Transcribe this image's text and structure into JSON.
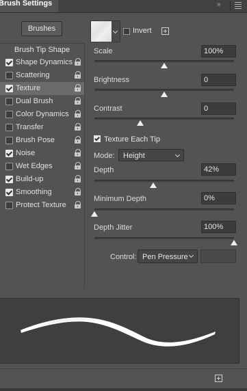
{
  "header": {
    "title": "Brush Settings",
    "collapse_glyph": "»",
    "menu_icon": "hamburger-menu-icon"
  },
  "left": {
    "brushes_button": "Brushes",
    "tip_shape": "Brush Tip Shape",
    "options": [
      {
        "label": "Shape Dynamics",
        "checked": true
      },
      {
        "label": "Scattering",
        "checked": false
      },
      {
        "label": "Texture",
        "checked": true,
        "selected": true
      },
      {
        "label": "Dual Brush",
        "checked": false
      },
      {
        "label": "Color Dynamics",
        "checked": false
      },
      {
        "label": "Transfer",
        "checked": false
      },
      {
        "label": "Brush Pose",
        "checked": false
      },
      {
        "label": "Noise",
        "checked": true
      },
      {
        "label": "Wet Edges",
        "checked": false
      },
      {
        "label": "Build-up",
        "checked": true
      },
      {
        "label": "Smoothing",
        "checked": true
      },
      {
        "label": "Protect Texture",
        "checked": false
      }
    ]
  },
  "texture": {
    "invert_label": "Invert",
    "invert_checked": false,
    "scale_label": "Scale",
    "scale_value": "100%",
    "scale_level": 0.5,
    "brightness_label": "Brightness",
    "brightness_value": "0",
    "brightness_level": 0.5,
    "contrast_label": "Contrast",
    "contrast_value": "0",
    "contrast_level": 0.33,
    "each_tip_label": "Texture Each Tip",
    "each_tip_checked": true,
    "mode_label": "Mode:",
    "mode_value": "Height",
    "depth_label": "Depth",
    "depth_value": "42%",
    "depth_level": 0.42,
    "min_depth_label": "Minimum Depth",
    "min_depth_value": "0%",
    "min_depth_level": 0.0,
    "jitter_label": "Depth Jitter",
    "jitter_value": "100%",
    "jitter_level": 1.0,
    "control_label": "Control:",
    "control_value": "Pen Pressure"
  },
  "colors": {
    "panel_bg": "#535353",
    "input_bg": "#3c3c3c",
    "preview_bg": "#3f3f3f",
    "stroke": "#ffffff"
  }
}
